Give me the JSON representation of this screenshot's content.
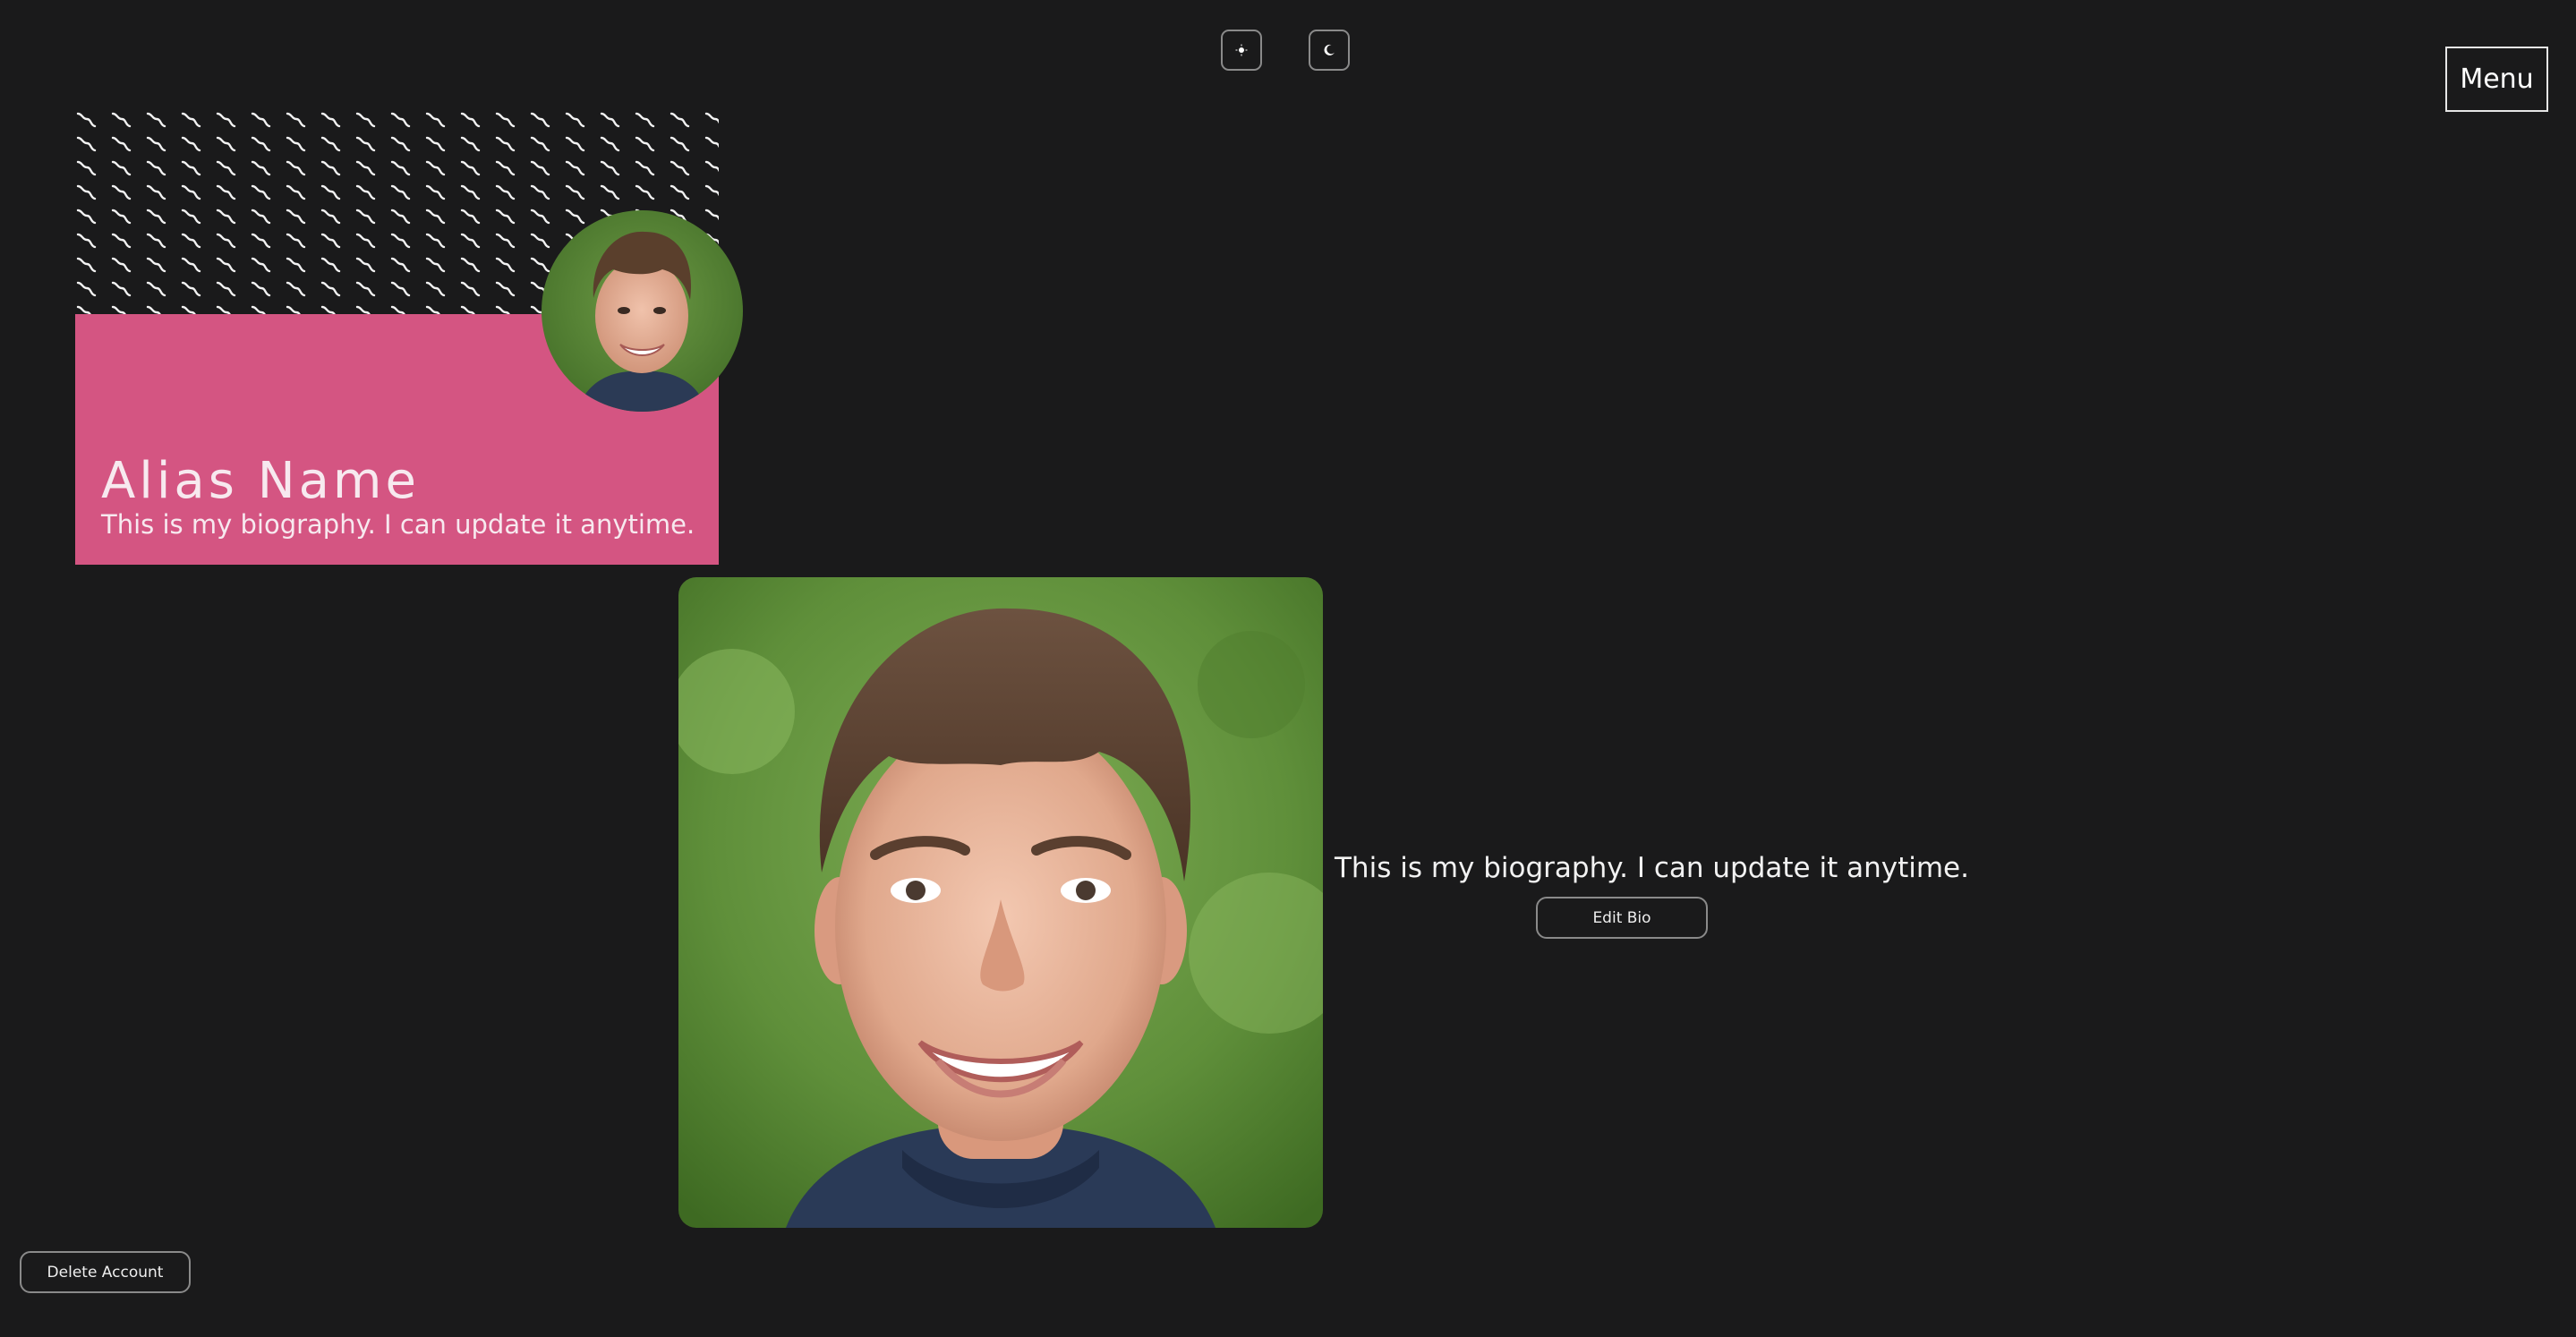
{
  "theme": {
    "light_icon": "sun-icon",
    "dark_icon": "moon-icon"
  },
  "menu": {
    "label": "Menu"
  },
  "profile_card": {
    "name": "Alias Name",
    "bio": "This is my biography. I can update it anytime.",
    "pattern": "squiggle-pattern",
    "accent": "#d45582"
  },
  "bio_section": {
    "text": "This is my biography. I can update it anytime.",
    "edit_label": "Edit Bio"
  },
  "account": {
    "delete_label": "Delete Account"
  }
}
